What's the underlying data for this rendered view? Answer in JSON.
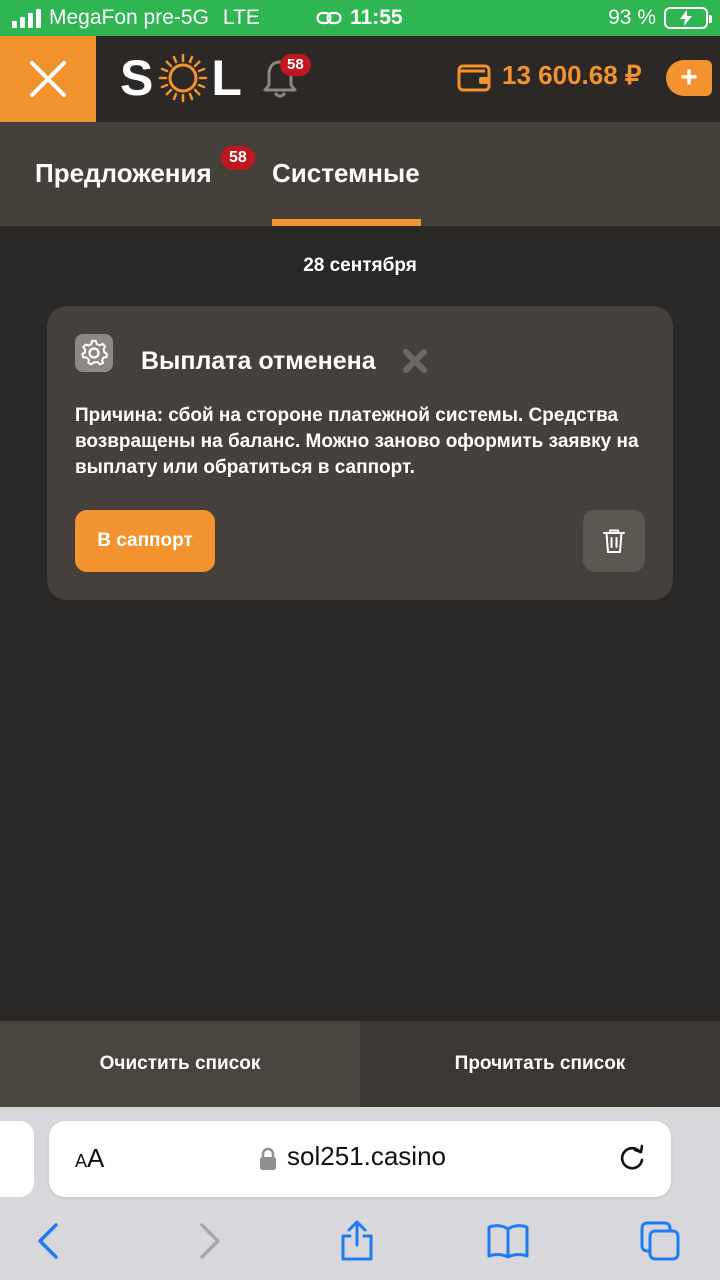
{
  "status_bar": {
    "carrier": "MegaFon pre-5G",
    "network": "LTE",
    "time": "11:55",
    "battery": "93 %"
  },
  "header": {
    "logo_text_left": "S",
    "logo_text_right": "L",
    "notifications_count": "58",
    "balance": "13 600.68 ₽",
    "add_label": "+"
  },
  "tabs": [
    {
      "label": "Предложения",
      "badge": "58"
    },
    {
      "label": "Системные",
      "active": true
    }
  ],
  "date_label": "28 сентября",
  "notification": {
    "title": "Выплата отменена",
    "text": "Причина: сбой на стороне платежной системы. Средства возвращены на баланс. Можно заново оформить заявку на выплату или обратиться в саппорт.",
    "support_button": "В саппорт"
  },
  "actions": {
    "clear": "Очистить список",
    "read": "Прочитать список"
  },
  "browser": {
    "aa_small": "A",
    "aa_big": "A",
    "url": "sol251.casino"
  },
  "colors": {
    "accent": "#f39330",
    "badge": "#c0171f",
    "status_bar": "#2fb552",
    "background": "#2a2826",
    "card": "#45403b"
  },
  "icons": [
    "close-icon",
    "sun-icon",
    "bell-icon",
    "wallet-icon",
    "plus-icon",
    "gear-icon",
    "x-icon",
    "trash-icon",
    "lock-icon",
    "reload-icon",
    "back-icon",
    "forward-icon",
    "share-icon",
    "bookmarks-icon",
    "tabs-icon"
  ]
}
